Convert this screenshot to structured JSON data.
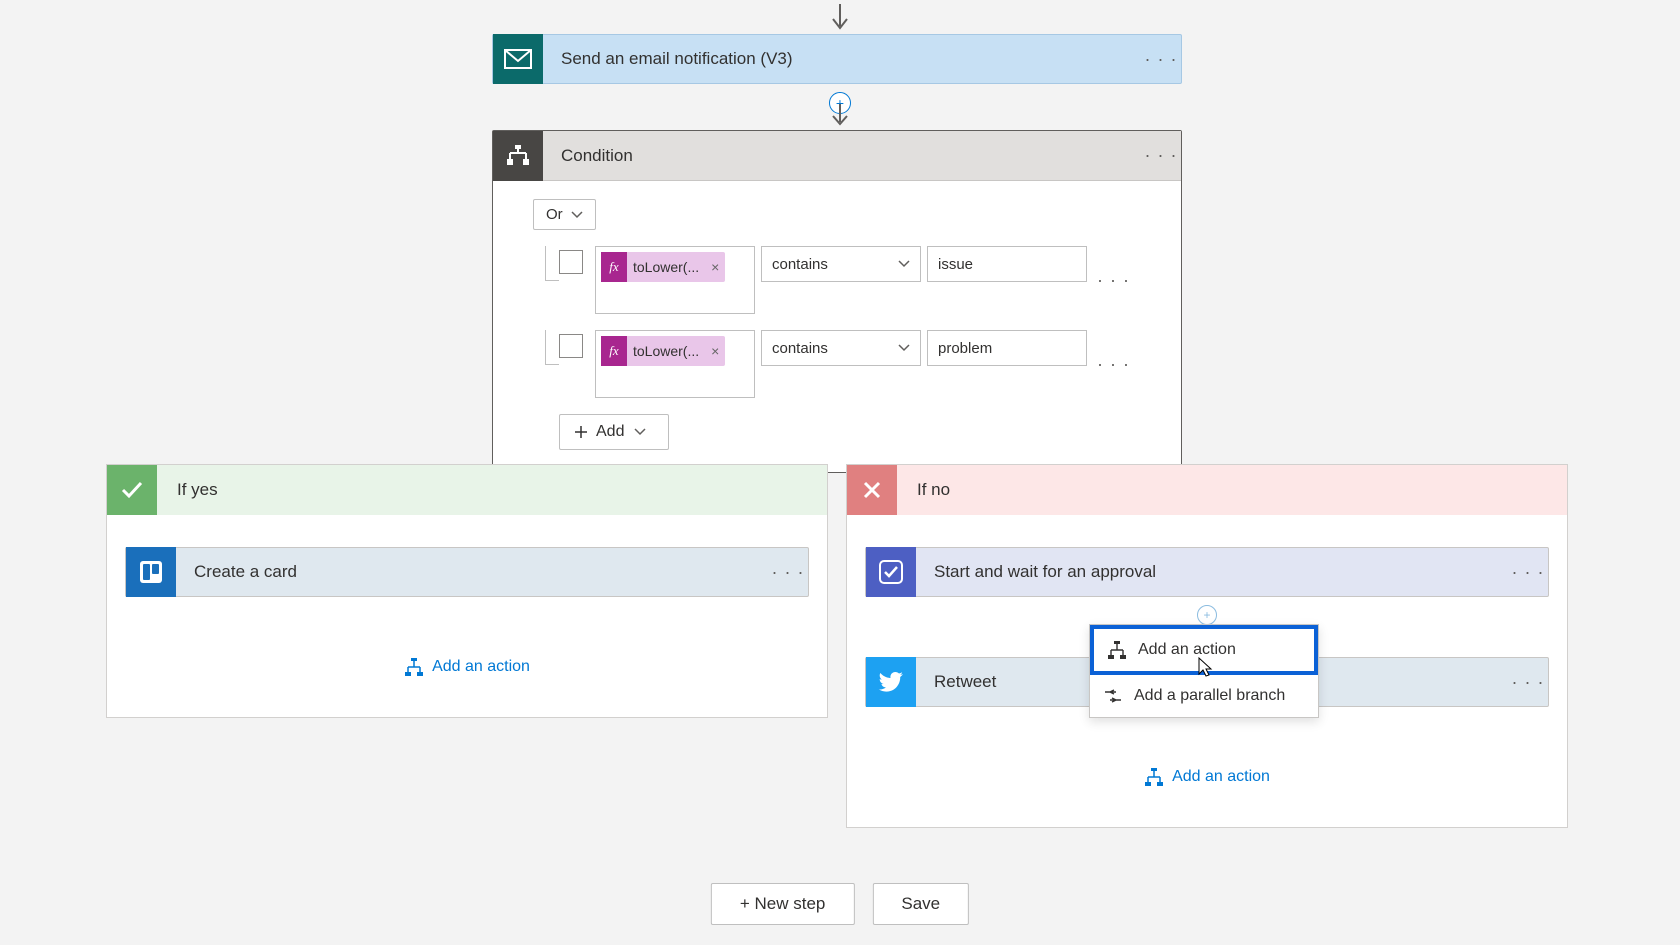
{
  "flow": {
    "email_action": {
      "label": "Send an email notification (V3)"
    },
    "condition": {
      "title": "Condition",
      "group_operator": "Or",
      "rules": [
        {
          "expression": "toLower(...",
          "operator": "contains",
          "value": "issue"
        },
        {
          "expression": "toLower(...",
          "operator": "contains",
          "value": "problem"
        }
      ],
      "add_button": "Add"
    },
    "branches": {
      "yes": {
        "label": "If yes",
        "actions": [
          {
            "kind": "trello",
            "label": "Create a card"
          }
        ],
        "add_action": "Add an action"
      },
      "no": {
        "label": "If no",
        "actions": [
          {
            "kind": "approval",
            "label": "Start and wait for an approval"
          },
          {
            "kind": "twitter",
            "label": "Retweet"
          }
        ],
        "add_action": "Add an action"
      }
    },
    "insert_popup": {
      "add_action": "Add an action",
      "add_parallel": "Add a parallel branch"
    },
    "footer": {
      "new_step": "+ New step",
      "save": "Save"
    }
  }
}
